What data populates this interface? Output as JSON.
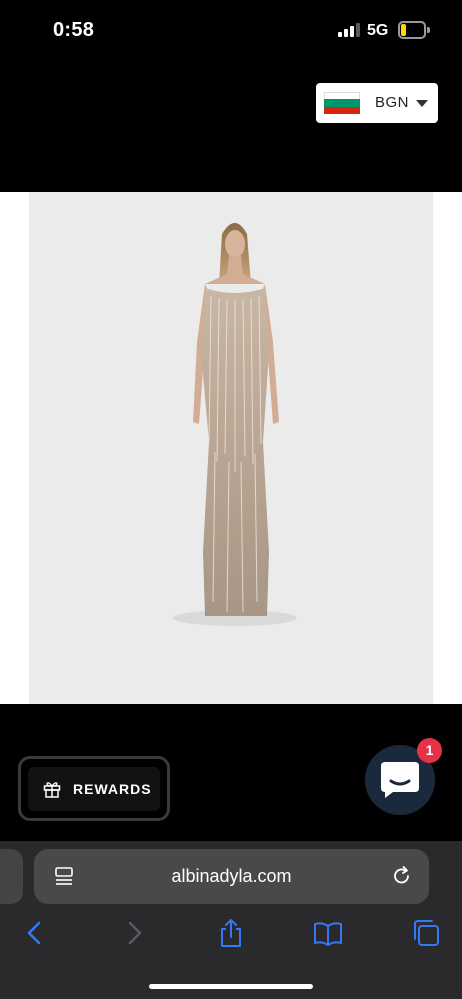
{
  "status_bar": {
    "time": "0:58",
    "network": "5G",
    "battery_level": 0.15
  },
  "currency_selector": {
    "code": "BGN",
    "flag_colors": [
      "#ffffff",
      "#00966e",
      "#d62612"
    ]
  },
  "product": {
    "image_label": "model-in-beaded-fringe-gown-photo"
  },
  "rewards": {
    "label": "REWARDS"
  },
  "chat": {
    "badge_count": "1"
  },
  "browser": {
    "url": "albinadyla.com",
    "toolbar": [
      "back",
      "forward",
      "share",
      "bookmarks",
      "tabs"
    ]
  },
  "colors": {
    "accent": "#3478f6",
    "badge": "#e63247",
    "chat_bubble": "#1a2a3c"
  }
}
